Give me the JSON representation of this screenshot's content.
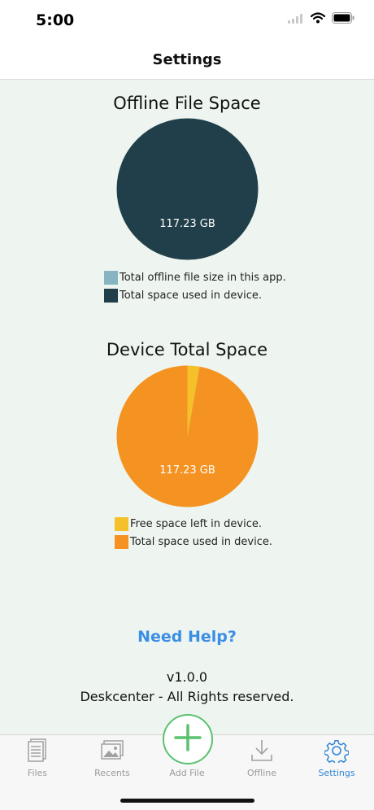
{
  "status_bar": {
    "time": "5:00"
  },
  "nav": {
    "title": "Settings"
  },
  "offline_chart": {
    "title": "Offline File Space",
    "center_label": "117.23 GB",
    "legend": [
      {
        "label": "Total offline file size in this app.",
        "color": "#86b4c0"
      },
      {
        "label": "Total space used in device.",
        "color": "#213f4a"
      }
    ]
  },
  "device_chart": {
    "title": "Device Total Space",
    "center_label": "117.23 GB",
    "legend": [
      {
        "label": "Free space left in device.",
        "color": "#f5c12a"
      },
      {
        "label": "Total space used in device.",
        "color": "#f59322"
      }
    ]
  },
  "chart_data": [
    {
      "type": "pie",
      "title": "Offline File Space",
      "categories": [
        "Total offline file size in this app.",
        "Total space used in device."
      ],
      "values": [
        0,
        117.23
      ],
      "colors": [
        "#86b4c0",
        "#213f4a"
      ],
      "unit": "GB"
    },
    {
      "type": "pie",
      "title": "Device Total Space",
      "categories": [
        "Free space left in device.",
        "Total space used in device."
      ],
      "values": [
        3.3,
        117.23
      ],
      "colors": [
        "#f5c12a",
        "#f59322"
      ],
      "unit": "GB"
    }
  ],
  "help": {
    "label": "Need Help?"
  },
  "footer": {
    "version": "v1.0.0",
    "copyright": "Deskcenter - All Rights reserved."
  },
  "tabs": [
    {
      "label": "Files",
      "icon": "files-icon",
      "active": false
    },
    {
      "label": "Recents",
      "icon": "recents-icon",
      "active": false
    },
    {
      "label": "Add File",
      "icon": "plus-icon",
      "active": false
    },
    {
      "label": "Offline",
      "icon": "download-icon",
      "active": false
    },
    {
      "label": "Settings",
      "icon": "gear-icon",
      "active": true
    }
  ],
  "colors": {
    "accent": "#2f86d6",
    "add_button": "#5ac26e",
    "background": "#eef5f0"
  }
}
